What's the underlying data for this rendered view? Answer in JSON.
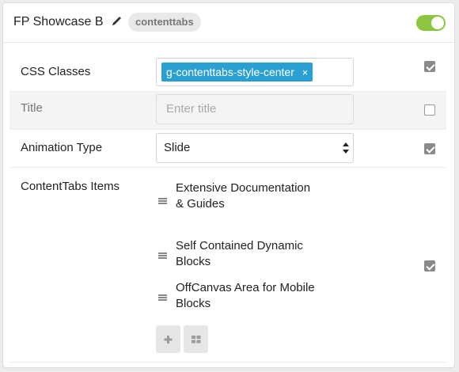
{
  "header": {
    "title": "FP Showcase B",
    "tag": "contenttabs",
    "enabled": true
  },
  "fields": {
    "css_classes": {
      "label": "CSS Classes",
      "chip": "g-contenttabs-style-center",
      "chip_remove": "×",
      "checked": true
    },
    "title": {
      "label": "Title",
      "placeholder": "Enter title",
      "checked": false
    },
    "animation": {
      "label": "Animation Type",
      "value": "Slide",
      "checked": true
    },
    "items": {
      "label": "ContentTabs Items",
      "list": [
        {
          "text": "Extensive Documentation & Guides"
        },
        {
          "text": "Self Contained Dynamic Blocks"
        },
        {
          "text": "OffCanvas Area for Mobile Blocks"
        }
      ],
      "checked": true
    }
  },
  "icons": {
    "edit": "pencil-icon",
    "drag": "drag-handle-icon",
    "add": "plus-icon",
    "grid": "grid-icon"
  },
  "colors": {
    "chip": "#2aa0d2",
    "toggle": "#8cc63f"
  }
}
